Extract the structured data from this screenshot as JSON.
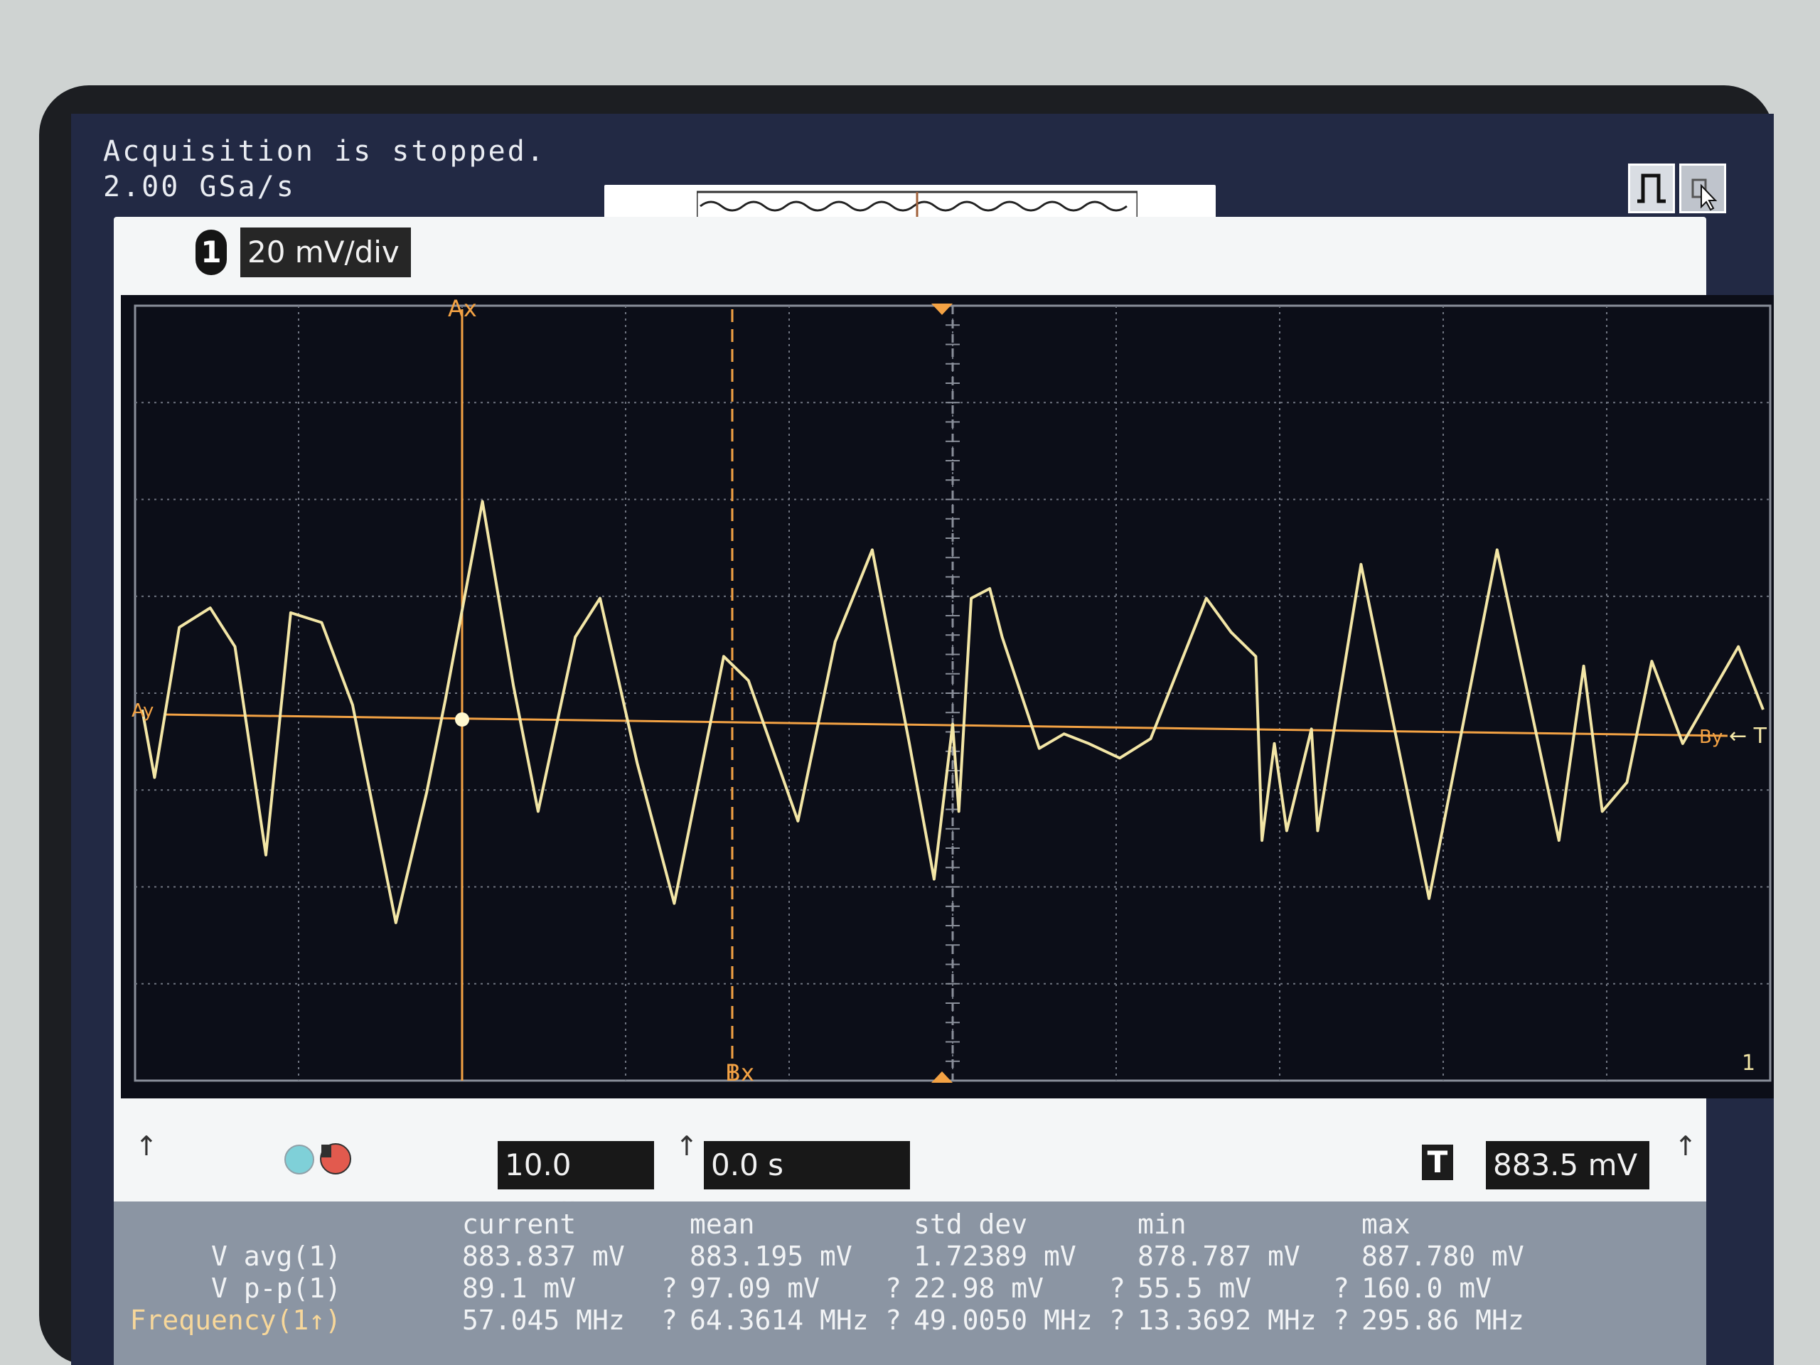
{
  "status": {
    "message": "Acquisition is stopped.",
    "sample_rate": "2.00 GSa/s"
  },
  "channel": {
    "number": "1",
    "scale": "20 mV/div"
  },
  "markers": {
    "a": "Ax",
    "b": "Bx",
    "a_level": "Ay",
    "b_level": "By",
    "trigger_level": "← T",
    "ground": "1"
  },
  "timebase": {
    "scale": "10.0 ns/div",
    "delay": "0.0 s"
  },
  "trigger": {
    "icon": "T",
    "level": "883.5 mV"
  },
  "trace_color": "#f3e6a6",
  "marker_color": "#f3a244",
  "measurements": {
    "headers": [
      "current",
      "mean",
      "std dev",
      "min",
      "max"
    ],
    "rows": [
      {
        "label": "V avg(1)",
        "values": [
          "883.837 mV",
          "883.195 mV",
          "1.72389 mV",
          "878.787 mV",
          "887.780 mV"
        ],
        "flags": [
          "",
          "",
          "",
          "",
          ""
        ]
      },
      {
        "label": "V p-p(1)",
        "values": [
          "89.1 mV",
          "97.09 mV",
          "22.98 mV",
          "55.5 mV",
          "160.0 mV"
        ],
        "flags": [
          "",
          "?",
          "?",
          "?",
          "?"
        ]
      },
      {
        "label": "Frequency(1↑)",
        "values": [
          "57.045 MHz",
          "64.3614 MHz",
          "49.0050 MHz",
          "13.3692 MHz",
          "295.86 MHz"
        ],
        "flags": [
          "",
          "?",
          "?",
          "?",
          "?"
        ]
      }
    ]
  },
  "waveform": [
    [
      0,
      0.05
    ],
    [
      10,
      -0.65
    ],
    [
      30,
      0.9
    ],
    [
      55,
      1.1
    ],
    [
      75,
      0.7
    ],
    [
      100,
      -1.45
    ],
    [
      120,
      1.05
    ],
    [
      145,
      0.95
    ],
    [
      170,
      0.1
    ],
    [
      205,
      -2.15
    ],
    [
      230,
      -0.8
    ],
    [
      245,
      0.15
    ],
    [
      275,
      2.2
    ],
    [
      300,
      0.3
    ],
    [
      320,
      -1.0
    ],
    [
      350,
      0.8
    ],
    [
      370,
      1.2
    ],
    [
      400,
      -0.5
    ],
    [
      430,
      -1.95
    ],
    [
      470,
      0.6
    ],
    [
      490,
      0.35
    ],
    [
      530,
      -1.1
    ],
    [
      560,
      0.75
    ],
    [
      590,
      1.7
    ],
    [
      620,
      -0.3
    ],
    [
      640,
      -1.7
    ],
    [
      655,
      -0.1
    ],
    [
      660,
      -1.0
    ],
    [
      670,
      1.2
    ],
    [
      685,
      1.3
    ],
    [
      695,
      0.8
    ],
    [
      725,
      -0.35
    ],
    [
      745,
      -0.2
    ],
    [
      765,
      -0.3
    ],
    [
      790,
      -0.45
    ],
    [
      815,
      -0.25
    ],
    [
      860,
      1.2
    ],
    [
      880,
      0.85
    ],
    [
      900,
      0.6
    ],
    [
      905,
      -1.3
    ],
    [
      915,
      -0.3
    ],
    [
      925,
      -1.2
    ],
    [
      945,
      -0.15
    ],
    [
      950,
      -1.2
    ],
    [
      985,
      1.55
    ],
    [
      1040,
      -1.9
    ],
    [
      1095,
      1.7
    ],
    [
      1145,
      -1.3
    ],
    [
      1165,
      0.5
    ],
    [
      1180,
      -1.0
    ],
    [
      1200,
      -0.7
    ],
    [
      1220,
      0.55
    ],
    [
      1245,
      -0.3
    ],
    [
      1290,
      0.7
    ],
    [
      1310,
      0.05
    ]
  ]
}
